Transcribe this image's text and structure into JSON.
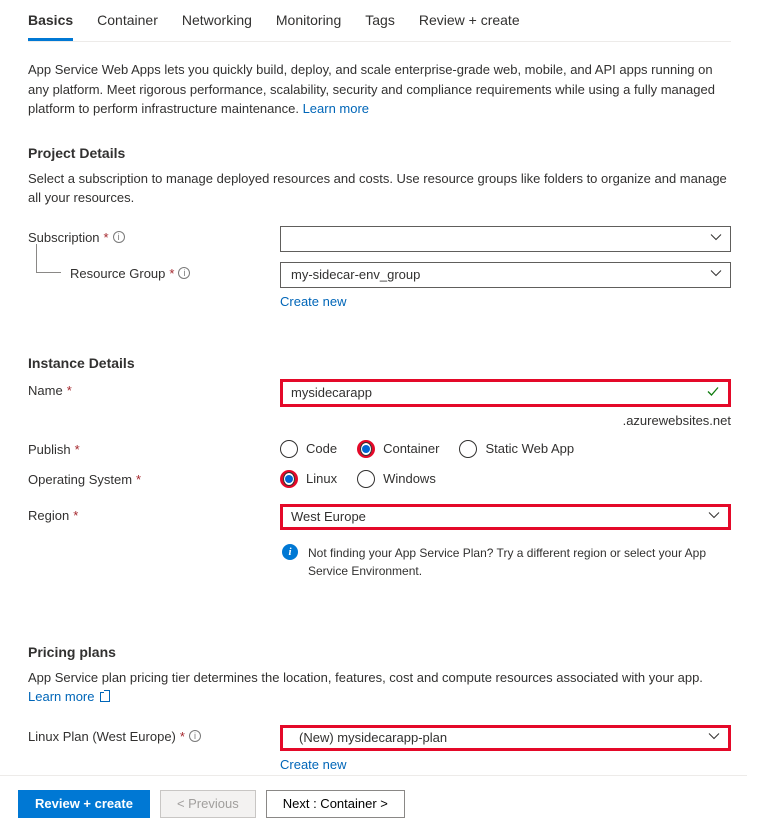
{
  "tabs": [
    "Basics",
    "Container",
    "Networking",
    "Monitoring",
    "Tags",
    "Review + create"
  ],
  "activeTab": "Basics",
  "intro": {
    "text": "App Service Web Apps lets you quickly build, deploy, and scale enterprise-grade web, mobile, and API apps running on any platform. Meet rigorous performance, scalability, security and compliance requirements while using a fully managed platform to perform infrastructure maintenance.  ",
    "learnMore": "Learn more"
  },
  "projectDetails": {
    "title": "Project Details",
    "desc": "Select a subscription to manage deployed resources and costs. Use resource groups like folders to organize and manage all your resources.",
    "subscriptionLabel": "Subscription",
    "subscriptionValue": "",
    "resourceGroupLabel": "Resource Group",
    "resourceGroupValue": "my-sidecar-env_group",
    "createNew": "Create new"
  },
  "instanceDetails": {
    "title": "Instance Details",
    "nameLabel": "Name",
    "nameValue": "mysidecarapp",
    "suffix": ".azurewebsites.net",
    "publishLabel": "Publish",
    "publishOptions": [
      "Code",
      "Container",
      "Static Web App"
    ],
    "publishSelected": "Container",
    "osLabel": "Operating System",
    "osOptions": [
      "Linux",
      "Windows"
    ],
    "osSelected": "Linux",
    "regionLabel": "Region",
    "regionValue": "West Europe",
    "infoText": "Not finding your App Service Plan? Try a different region or select your App Service Environment."
  },
  "pricing": {
    "title": "Pricing plans",
    "desc": "App Service plan pricing tier determines the location, features, cost and compute resources associated with your app. ",
    "learnMore": "Learn more",
    "planLabel": "Linux Plan (West Europe)",
    "planValue": "(New) mysidecarapp-plan",
    "createNew": "Create new"
  },
  "footer": {
    "review": "Review + create",
    "previous": "< Previous",
    "next": "Next : Container >"
  }
}
